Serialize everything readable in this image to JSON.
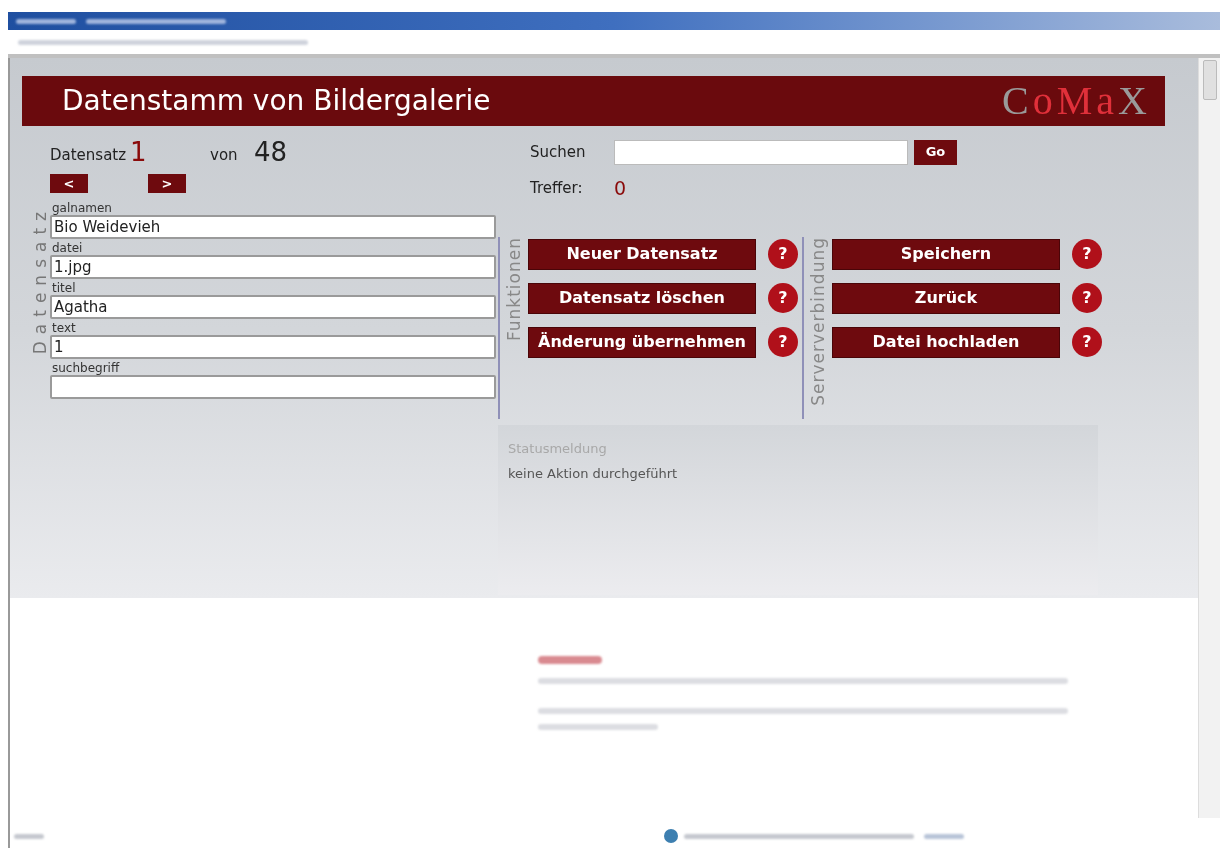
{
  "header": {
    "title": "Datenstamm von Bildergalerie",
    "logo": "CoMaX"
  },
  "navigation": {
    "record_label": "Datensatz",
    "record_current": "1",
    "of_label": "von",
    "record_total": "48",
    "prev_button": "<",
    "next_button": ">"
  },
  "search": {
    "label": "Suchen",
    "button": "Go",
    "hits_label": "Treffer:",
    "hits": "0"
  },
  "form": {
    "side_label": "Datensatz",
    "fields": [
      {
        "label": "galnamen",
        "value": "Bio Weidevieh"
      },
      {
        "label": "datei",
        "value": "1.jpg"
      },
      {
        "label": "titel",
        "value": "Agatha"
      },
      {
        "label": "text",
        "value": "1"
      },
      {
        "label": "suchbegriff"
      }
    ]
  },
  "groups": [
    {
      "label": "Funktionen",
      "buttons": [
        {
          "label": "Neuer Datensatz",
          "help": "?"
        },
        {
          "label": "Datensatz löschen",
          "help": "?"
        },
        {
          "label": "Änderung übernehmen",
          "help": "?"
        }
      ]
    },
    {
      "label": "Serververbindung",
      "buttons": [
        {
          "label": "Speichern",
          "help": "?"
        },
        {
          "label": "Zurück",
          "help": "?"
        },
        {
          "label": "Datei hochladen",
          "help": "?"
        }
      ]
    }
  ],
  "status": {
    "label": "Statusmeldung",
    "message": "keine Aktion durchgeführt"
  }
}
